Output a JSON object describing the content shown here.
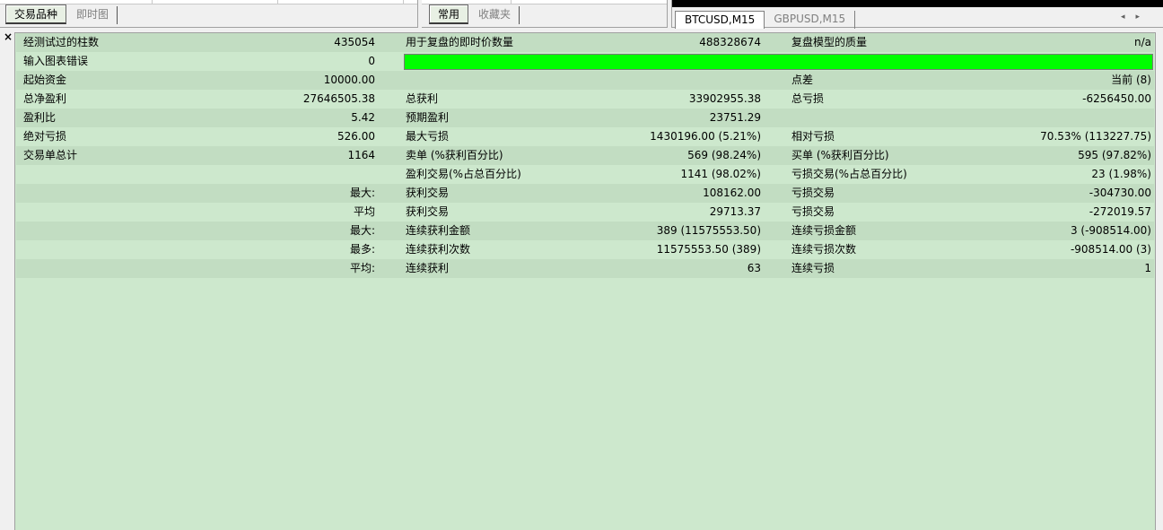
{
  "market_watch": {
    "tabs": [
      "交易品种",
      "即时图"
    ]
  },
  "navigator": {
    "tabs": [
      "常用",
      "收藏夹"
    ]
  },
  "charts": {
    "tabs": [
      "BTCUSD,M15",
      "GBPUSD,M15"
    ]
  },
  "report": {
    "progress": {
      "value": 1.0,
      "color": "#00ff00"
    },
    "rows": [
      {
        "c1_label": "经测试过的柱数",
        "c1_value": "435054",
        "c2_label": "用于复盘的即时价数量",
        "c2_value": "488328674",
        "c3_label": "复盘模型的质量",
        "c3_value": "n/a"
      },
      {
        "c1_label": "输入图表错误",
        "c1_value": "0",
        "c2_label": "",
        "c2_value": "",
        "c3_label": "",
        "c3_value": ""
      },
      {
        "c1_label": "起始资金",
        "c1_value": "10000.00",
        "c2_label": "",
        "c2_value": "",
        "c3_label": "点差",
        "c3_value": "当前 (8)"
      },
      {
        "c1_label": "总净盈利",
        "c1_value": "27646505.38",
        "c2_label": "总获利",
        "c2_value": "33902955.38",
        "c3_label": "总亏损",
        "c3_value": "-6256450.00"
      },
      {
        "c1_label": "盈利比",
        "c1_value": "5.42",
        "c2_label": "预期盈利",
        "c2_value": "23751.29",
        "c3_label": "",
        "c3_value": ""
      },
      {
        "c1_label": "绝对亏损",
        "c1_value": "526.00",
        "c2_label": "最大亏损",
        "c2_value": "1430196.00 (5.21%)",
        "c3_label": "相对亏损",
        "c3_value": "70.53% (113227.75)"
      },
      {
        "c1_label": "交易单总计",
        "c1_value": "1164",
        "c2_label": "卖单 (%获利百分比)",
        "c2_value": "569 (98.24%)",
        "c3_label": "买单 (%获利百分比)",
        "c3_value": "595 (97.82%)"
      },
      {
        "c1_label": "",
        "c1_value": "",
        "c2_label": "盈利交易(%占总百分比)",
        "c2_value": "1141 (98.02%)",
        "c3_label": "亏损交易(%占总百分比)",
        "c3_value": "23 (1.98%)"
      },
      {
        "c1_label": "",
        "c1_value": "最大:",
        "c2_label": "获利交易",
        "c2_value": "108162.00",
        "c3_label": "亏损交易",
        "c3_value": "-304730.00"
      },
      {
        "c1_label": "",
        "c1_value": "平均",
        "c2_label": "获利交易",
        "c2_value": "29713.37",
        "c3_label": "亏损交易",
        "c3_value": "-272019.57"
      },
      {
        "c1_label": "",
        "c1_value": "最大:",
        "c2_label": "连续获利金额",
        "c2_value": "389 (11575553.50)",
        "c3_label": "连续亏损金额",
        "c3_value": "3 (-908514.00)"
      },
      {
        "c1_label": "",
        "c1_value": "最多:",
        "c2_label": "连续获利次数",
        "c2_value": "11575553.50 (389)",
        "c3_label": "连续亏损次数",
        "c3_value": "-908514.00 (3)"
      },
      {
        "c1_label": "",
        "c1_value": "平均:",
        "c2_label": "连续获利",
        "c2_value": "63",
        "c3_label": "连续亏损",
        "c3_value": "1"
      }
    ]
  },
  "colors": {
    "report_bg": "#cde8cd",
    "row_shade": "#c2ddc2",
    "progress_green": "#00ff00"
  },
  "icons": {
    "close": "close-icon",
    "scroll_left": "chevron-left-icon",
    "scroll_right": "chevron-right-icon"
  }
}
